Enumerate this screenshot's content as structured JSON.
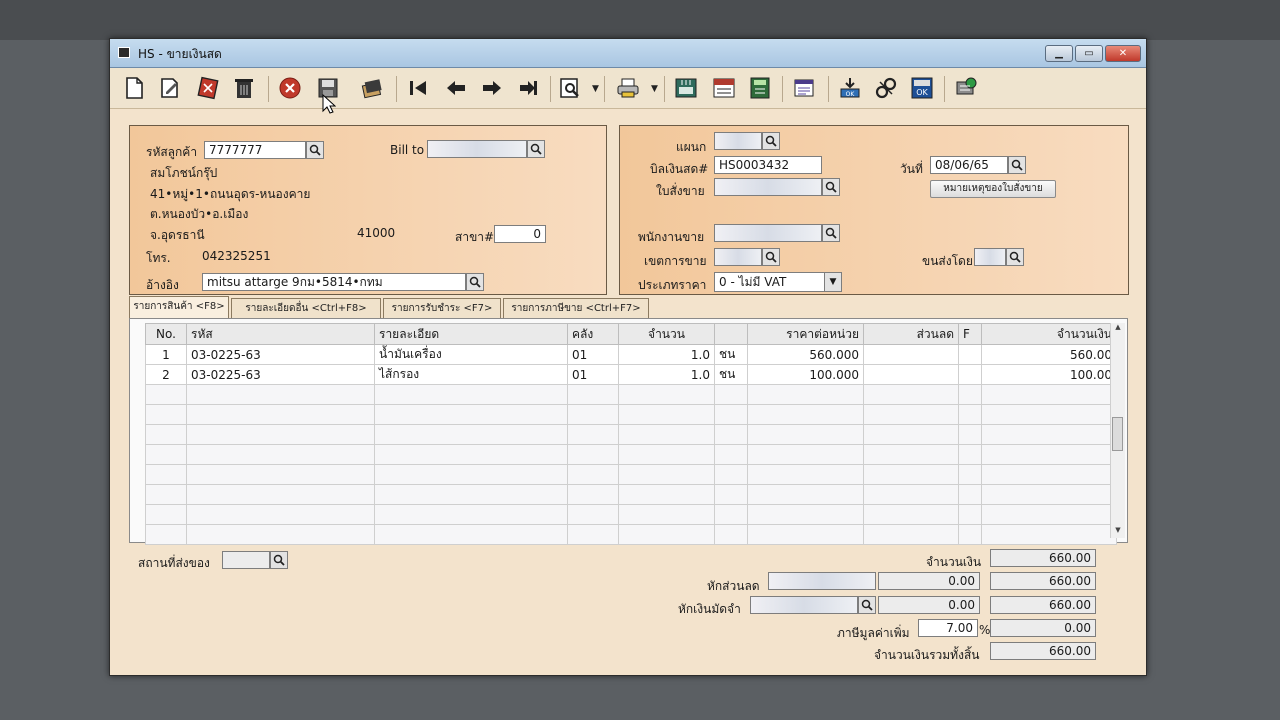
{
  "window": {
    "title": "HS - ขายเงินสด"
  },
  "toolbar": {
    "icons": [
      "new-document",
      "edit",
      "delete",
      "trash",
      "cancel",
      "save",
      "copy",
      "first",
      "previous",
      "next",
      "last",
      "preview",
      "print",
      "export",
      "import",
      "calculator",
      "report",
      "download-ok",
      "link",
      "ok",
      "network"
    ]
  },
  "customer": {
    "code_label": "รหัสลูกค้า",
    "code_value": "7777777",
    "name": "สมโภชน์กรุ๊ป",
    "address1": "41•หมู่•1•ถนนอุดร-หนองคาย",
    "address2": "ต.หนองบัว•อ.เมือง",
    "address3": "จ.อุดรธานี",
    "postcode": "41000",
    "branch_label": "สาขา#",
    "branch_value": "0",
    "phone_label": "โทร.",
    "phone_value": "042325251",
    "billto_label": "Bill to",
    "ref_label": "อ้างอิง",
    "ref_value": "mitsu attarge 9กม•5814•กทม"
  },
  "document": {
    "dept_label": "แผนก",
    "bill_label": "บิลเงินสด#",
    "bill_value": "HS0003432",
    "order_label": "ใบสั่งขาย",
    "date_label": "วันที่",
    "date_value": "08/06/65",
    "note_button": "หมายเหตุของใบสั่งขาย",
    "salesman_label": "พนักงานขาย",
    "area_label": "เขตการขาย",
    "ship_label": "ขนส่งโดย",
    "pricetype_label": "ประเภทราคา",
    "pricetype_value": "0 - ไม่มี VAT"
  },
  "tabs": [
    "รายการสินค้า <F8>",
    "รายละเอียดอื่น <Ctrl+F8>",
    "รายการรับชำระ <F7>",
    "รายการภาษีขาย <Ctrl+F7>"
  ],
  "grid": {
    "columns": [
      "No.",
      "รหัส",
      "รายละเอียด",
      "คลัง",
      "จำนวน",
      "",
      "ราคาต่อหน่วย",
      "ส่วนลด",
      "F",
      "จำนวนเงิน"
    ],
    "rows": [
      {
        "no": "1",
        "code": "03-0225-63",
        "desc": "น้ำมันเครื่อง",
        "wh": "01",
        "qty": "1.0",
        "unit": "ชน",
        "price": "560.000",
        "disc": "",
        "f": "",
        "amount": "560.00"
      },
      {
        "no": "2",
        "code": "03-0225-63",
        "desc": "ไส้กรอง",
        "wh": "01",
        "qty": "1.0",
        "unit": "ชน",
        "price": "100.000",
        "disc": "",
        "f": "",
        "amount": "100.00"
      }
    ]
  },
  "footer": {
    "ship_place_label": "สถานที่ส่งของ",
    "amount_label": "จำนวนเงิน",
    "amount_value": "660.00",
    "discount_label": "หักส่วนลด",
    "discount_value": "0.00",
    "after_discount": "660.00",
    "deposit_label": "หักเงินมัดจำ",
    "deposit_value": "0.00",
    "after_deposit": "660.00",
    "vat_label": "ภาษีมูลค่าเพิ่ม",
    "vat_rate": "7.00",
    "vat_unit": "%",
    "vat_value": "0.00",
    "total_label": "จำนวนเงินรวมทั้งสิ้น",
    "total_value": "660.00"
  }
}
